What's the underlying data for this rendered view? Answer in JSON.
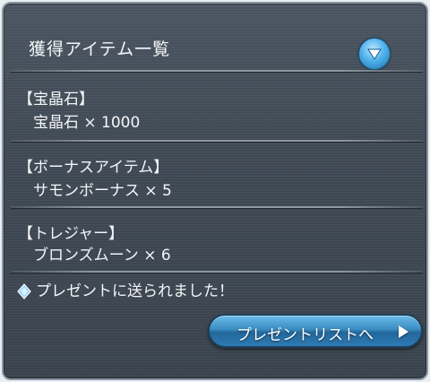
{
  "panel": {
    "title": "獲得アイテム一覧",
    "toggle_icon": "chevron-down-icon"
  },
  "sections": [
    {
      "heading": "【宝晶石】",
      "item": "宝晶石 × 1000"
    },
    {
      "heading": "【ボーナスアイテム】",
      "item": "サモンボーナス × 5"
    },
    {
      "heading": "【トレジャー】",
      "item": "ブロンズムーン × 6"
    }
  ],
  "notice": {
    "icon": "diamond-icon",
    "text": "プレゼントに送られました！"
  },
  "present_button": {
    "label": "プレゼントリストへ",
    "icon": "play-arrow-icon"
  },
  "colors": {
    "panel_bg": "#3f4954",
    "accent_blue": "#3a8cc2",
    "text": "#f4f6f8"
  }
}
